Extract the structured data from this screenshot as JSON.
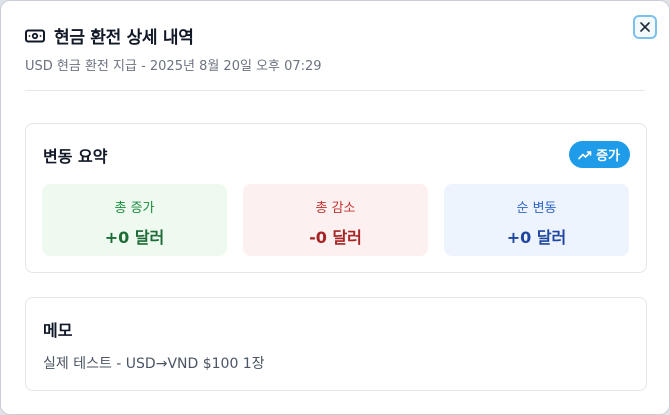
{
  "dialog": {
    "title": "현금 환전 상세 내역",
    "subtitle": "USD 현금 환전 지급 - 2025년 8월 20일 오후 07:29",
    "title_icon": "money-bill-icon",
    "close_icon": "close-icon"
  },
  "summary": {
    "title": "변동 요약",
    "badge_label": "증가",
    "badge_icon": "trending-up-icon",
    "stats": [
      {
        "label": "총 증가",
        "value": "+0 달러",
        "color": "#1a8a3c"
      },
      {
        "label": "총 감소",
        "value": "-0 달러",
        "color": "#c33232"
      },
      {
        "label": "순 변동",
        "value": "+0 달러",
        "color": "#2f64c8"
      }
    ]
  },
  "memo": {
    "title": "메모",
    "text": "실제 테스트 - USD→VND $100 1장"
  },
  "colors": {
    "accent": "#1e9be9",
    "increase_bg": "#eefaf0",
    "decrease_bg": "#fdf0f0",
    "net_bg": "#eef4fd"
  }
}
